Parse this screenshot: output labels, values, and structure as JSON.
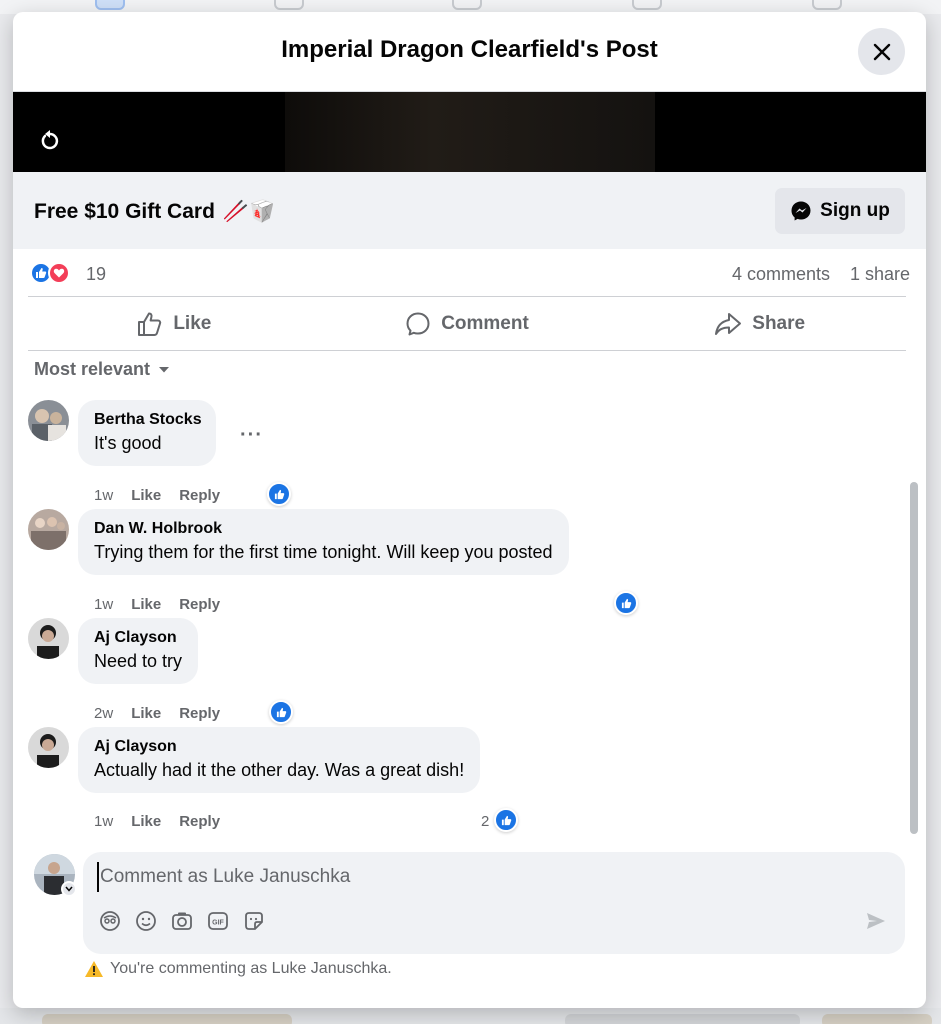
{
  "modal": {
    "title": "Imperial Dragon Clearfield's Post",
    "close_icon": "close-icon"
  },
  "video": {
    "replay_icon": "replay-icon"
  },
  "cta": {
    "text": "Free $10 Gift Card",
    "emoji": "🥢🥡",
    "button_label": "Sign up",
    "button_icon": "messenger-icon"
  },
  "stats": {
    "reaction_count": "19",
    "comments": "4 comments",
    "shares": "1 share"
  },
  "actions": {
    "like": "Like",
    "comment": "Comment",
    "share": "Share"
  },
  "sort": {
    "label": "Most relevant"
  },
  "comments": [
    {
      "name": "Bertha Stocks",
      "text": "It's good",
      "time": "1w",
      "like": "Like",
      "reply": "Reply",
      "reaction_count": ""
    },
    {
      "name": "Dan W. Holbrook",
      "text": "Trying them for the first time tonight. Will keep you posted",
      "time": "1w",
      "like": "Like",
      "reply": "Reply",
      "reaction_count": ""
    },
    {
      "name": "Aj Clayson",
      "text": "Need to try",
      "time": "2w",
      "like": "Like",
      "reply": "Reply",
      "reaction_count": ""
    },
    {
      "name": "Aj Clayson",
      "text": "Actually had it the other day. Was a great dish!",
      "time": "1w",
      "like": "Like",
      "reply": "Reply",
      "reaction_count": "2"
    }
  ],
  "composer": {
    "placeholder": "Comment as Luke Januschka",
    "value": "",
    "warning": "You're commenting as Luke Januschka."
  },
  "colors": {
    "accent": "#1b74e4",
    "love": "#f33e58",
    "secondary_text": "#65676b",
    "bubble": "#f0f2f5"
  }
}
